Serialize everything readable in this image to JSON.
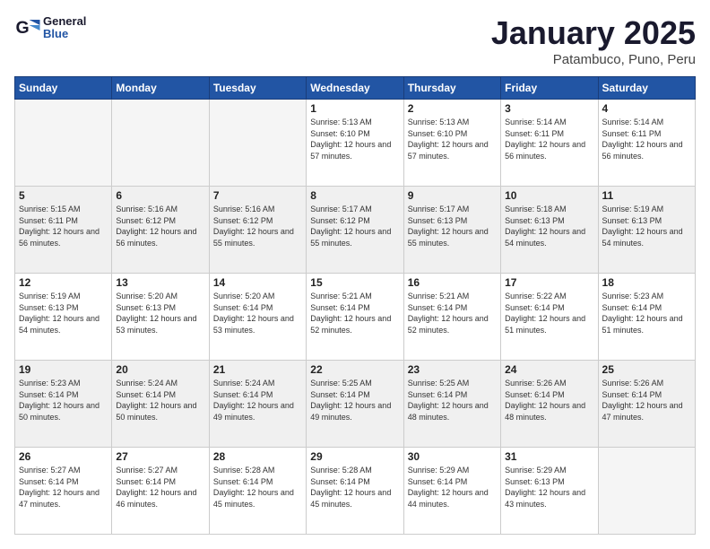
{
  "logo": {
    "general": "General",
    "blue": "Blue"
  },
  "title": "January 2025",
  "location": "Patambuco, Puno, Peru",
  "weekdays": [
    "Sunday",
    "Monday",
    "Tuesday",
    "Wednesday",
    "Thursday",
    "Friday",
    "Saturday"
  ],
  "weeks": [
    {
      "shaded": false,
      "days": [
        {
          "num": "",
          "empty": true
        },
        {
          "num": "",
          "empty": true
        },
        {
          "num": "",
          "empty": true
        },
        {
          "num": "1",
          "sunrise": "5:13 AM",
          "sunset": "6:10 PM",
          "daylight": "12 hours and 57 minutes."
        },
        {
          "num": "2",
          "sunrise": "5:13 AM",
          "sunset": "6:10 PM",
          "daylight": "12 hours and 57 minutes."
        },
        {
          "num": "3",
          "sunrise": "5:14 AM",
          "sunset": "6:11 PM",
          "daylight": "12 hours and 56 minutes."
        },
        {
          "num": "4",
          "sunrise": "5:14 AM",
          "sunset": "6:11 PM",
          "daylight": "12 hours and 56 minutes."
        }
      ]
    },
    {
      "shaded": true,
      "days": [
        {
          "num": "5",
          "sunrise": "5:15 AM",
          "sunset": "6:11 PM",
          "daylight": "12 hours and 56 minutes."
        },
        {
          "num": "6",
          "sunrise": "5:16 AM",
          "sunset": "6:12 PM",
          "daylight": "12 hours and 56 minutes."
        },
        {
          "num": "7",
          "sunrise": "5:16 AM",
          "sunset": "6:12 PM",
          "daylight": "12 hours and 55 minutes."
        },
        {
          "num": "8",
          "sunrise": "5:17 AM",
          "sunset": "6:12 PM",
          "daylight": "12 hours and 55 minutes."
        },
        {
          "num": "9",
          "sunrise": "5:17 AM",
          "sunset": "6:13 PM",
          "daylight": "12 hours and 55 minutes."
        },
        {
          "num": "10",
          "sunrise": "5:18 AM",
          "sunset": "6:13 PM",
          "daylight": "12 hours and 54 minutes."
        },
        {
          "num": "11",
          "sunrise": "5:19 AM",
          "sunset": "6:13 PM",
          "daylight": "12 hours and 54 minutes."
        }
      ]
    },
    {
      "shaded": false,
      "days": [
        {
          "num": "12",
          "sunrise": "5:19 AM",
          "sunset": "6:13 PM",
          "daylight": "12 hours and 54 minutes."
        },
        {
          "num": "13",
          "sunrise": "5:20 AM",
          "sunset": "6:13 PM",
          "daylight": "12 hours and 53 minutes."
        },
        {
          "num": "14",
          "sunrise": "5:20 AM",
          "sunset": "6:14 PM",
          "daylight": "12 hours and 53 minutes."
        },
        {
          "num": "15",
          "sunrise": "5:21 AM",
          "sunset": "6:14 PM",
          "daylight": "12 hours and 52 minutes."
        },
        {
          "num": "16",
          "sunrise": "5:21 AM",
          "sunset": "6:14 PM",
          "daylight": "12 hours and 52 minutes."
        },
        {
          "num": "17",
          "sunrise": "5:22 AM",
          "sunset": "6:14 PM",
          "daylight": "12 hours and 51 minutes."
        },
        {
          "num": "18",
          "sunrise": "5:23 AM",
          "sunset": "6:14 PM",
          "daylight": "12 hours and 51 minutes."
        }
      ]
    },
    {
      "shaded": true,
      "days": [
        {
          "num": "19",
          "sunrise": "5:23 AM",
          "sunset": "6:14 PM",
          "daylight": "12 hours and 50 minutes."
        },
        {
          "num": "20",
          "sunrise": "5:24 AM",
          "sunset": "6:14 PM",
          "daylight": "12 hours and 50 minutes."
        },
        {
          "num": "21",
          "sunrise": "5:24 AM",
          "sunset": "6:14 PM",
          "daylight": "12 hours and 49 minutes."
        },
        {
          "num": "22",
          "sunrise": "5:25 AM",
          "sunset": "6:14 PM",
          "daylight": "12 hours and 49 minutes."
        },
        {
          "num": "23",
          "sunrise": "5:25 AM",
          "sunset": "6:14 PM",
          "daylight": "12 hours and 48 minutes."
        },
        {
          "num": "24",
          "sunrise": "5:26 AM",
          "sunset": "6:14 PM",
          "daylight": "12 hours and 48 minutes."
        },
        {
          "num": "25",
          "sunrise": "5:26 AM",
          "sunset": "6:14 PM",
          "daylight": "12 hours and 47 minutes."
        }
      ]
    },
    {
      "shaded": false,
      "days": [
        {
          "num": "26",
          "sunrise": "5:27 AM",
          "sunset": "6:14 PM",
          "daylight": "12 hours and 47 minutes."
        },
        {
          "num": "27",
          "sunrise": "5:27 AM",
          "sunset": "6:14 PM",
          "daylight": "12 hours and 46 minutes."
        },
        {
          "num": "28",
          "sunrise": "5:28 AM",
          "sunset": "6:14 PM",
          "daylight": "12 hours and 45 minutes."
        },
        {
          "num": "29",
          "sunrise": "5:28 AM",
          "sunset": "6:14 PM",
          "daylight": "12 hours and 45 minutes."
        },
        {
          "num": "30",
          "sunrise": "5:29 AM",
          "sunset": "6:14 PM",
          "daylight": "12 hours and 44 minutes."
        },
        {
          "num": "31",
          "sunrise": "5:29 AM",
          "sunset": "6:13 PM",
          "daylight": "12 hours and 43 minutes."
        },
        {
          "num": "",
          "empty": true
        }
      ]
    }
  ]
}
